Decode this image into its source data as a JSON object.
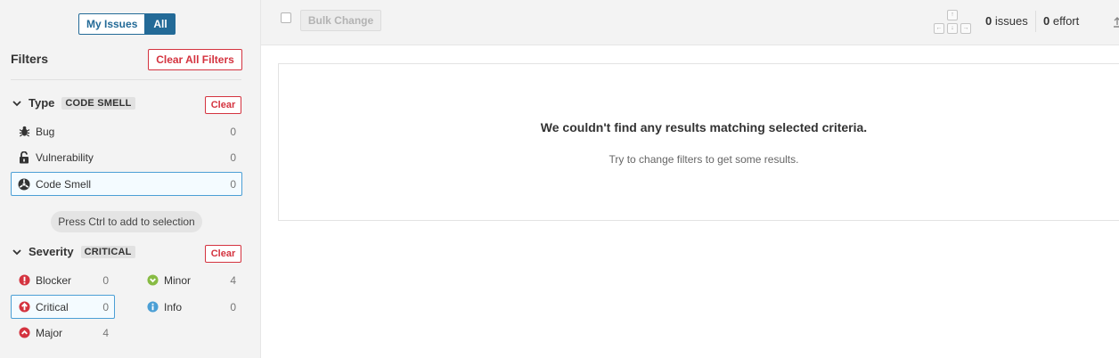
{
  "sidebar": {
    "scope_toggle": {
      "my_issues": "My Issues",
      "all": "All"
    },
    "filters_title": "Filters",
    "clear_all": "Clear All Filters",
    "type_facet": {
      "name": "Type",
      "selected_value": "CODE SMELL",
      "clear": "Clear",
      "items": [
        {
          "label": "Bug",
          "count": "0",
          "icon": "bug-icon"
        },
        {
          "label": "Vulnerability",
          "count": "0",
          "icon": "lock-open-icon"
        },
        {
          "label": "Code Smell",
          "count": "0",
          "icon": "code-smell-icon",
          "selected": true
        }
      ]
    },
    "hint": "Press Ctrl to add to selection",
    "severity_facet": {
      "name": "Severity",
      "selected_value": "CRITICAL",
      "clear": "Clear",
      "items": [
        {
          "label": "Blocker",
          "count": "0",
          "icon": "blocker-icon",
          "color": "#d4333f"
        },
        {
          "label": "Minor",
          "count": "4",
          "icon": "minor-icon",
          "color": "#87bb43"
        },
        {
          "label": "Critical",
          "count": "0",
          "icon": "critical-icon",
          "color": "#d4333f",
          "selected": true
        },
        {
          "label": "Info",
          "count": "0",
          "icon": "info-icon",
          "color": "#4b9fd5"
        },
        {
          "label": "Major",
          "count": "4",
          "icon": "major-icon",
          "color": "#d4333f"
        }
      ]
    }
  },
  "toolbar": {
    "bulk_change": "Bulk Change",
    "issues_count": "0",
    "issues_label": "issues",
    "effort_count": "0",
    "effort_label": "effort"
  },
  "results": {
    "empty_title": "We couldn't find any results matching selected criteria.",
    "empty_subtitle": "Try to change filters to get some results."
  },
  "colors": {
    "accent": "#236a97",
    "danger": "#d4333f",
    "selection_border": "#4b9fd5"
  }
}
